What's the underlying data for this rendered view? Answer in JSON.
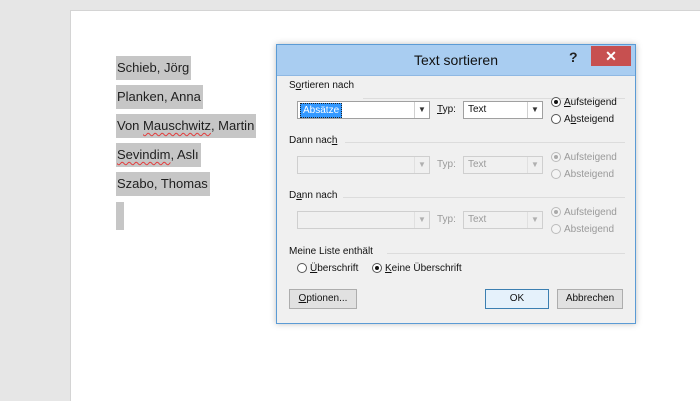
{
  "document": {
    "lines": [
      "Schieb, Jörg",
      "Planken, Anna",
      "Mauschwitz",
      "Sevindim"
    ],
    "line3_prefix": "Von ",
    "line3_suffix": ", Martin",
    "line4_suffix": ", Aslı",
    "line5": "Szabo, Thomas"
  },
  "dialog": {
    "title": "Text sortieren",
    "help_label": "?",
    "close_label": "✕",
    "section1": {
      "label": "Sortieren nach",
      "field": "Absätze",
      "type_label": "Typ:",
      "type": "Text",
      "asc": "Aufsteigend",
      "desc": "Absteigend",
      "selected": "asc"
    },
    "section2": {
      "label": "Dann nach",
      "field": "",
      "type_label": "Typ:",
      "type": "Text",
      "asc": "Aufsteigend",
      "desc": "Absteigend"
    },
    "section3": {
      "label": "Dann nach",
      "field": "",
      "type_label": "Typ:",
      "type": "Text",
      "asc": "Aufsteigend",
      "desc": "Absteigend"
    },
    "list": {
      "label": "Meine Liste enthält",
      "header": "Überschrift",
      "no_header": "Keine Überschrift",
      "selected": "no_header"
    },
    "buttons": {
      "options": "Optionen...",
      "ok": "OK",
      "cancel": "Abbrechen"
    }
  },
  "colors": {
    "titlebar": "#a9cdf1",
    "close": "#c75050",
    "selection": "#c6c6c6",
    "highlight": "#3399ff"
  }
}
